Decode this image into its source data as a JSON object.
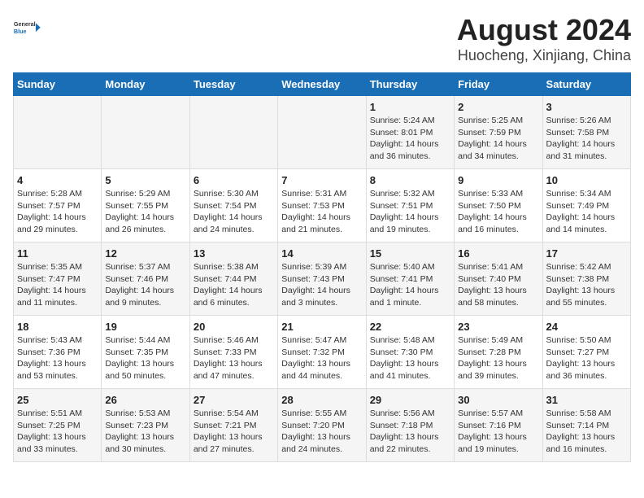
{
  "logo": {
    "line1": "General",
    "line2": "Blue"
  },
  "title": "August 2024",
  "subtitle": "Huocheng, Xinjiang, China",
  "weekdays": [
    "Sunday",
    "Monday",
    "Tuesday",
    "Wednesday",
    "Thursday",
    "Friday",
    "Saturday"
  ],
  "weeks": [
    [
      {
        "day": "",
        "info": ""
      },
      {
        "day": "",
        "info": ""
      },
      {
        "day": "",
        "info": ""
      },
      {
        "day": "",
        "info": ""
      },
      {
        "day": "1",
        "info": "Sunrise: 5:24 AM\nSunset: 8:01 PM\nDaylight: 14 hours\nand 36 minutes."
      },
      {
        "day": "2",
        "info": "Sunrise: 5:25 AM\nSunset: 7:59 PM\nDaylight: 14 hours\nand 34 minutes."
      },
      {
        "day": "3",
        "info": "Sunrise: 5:26 AM\nSunset: 7:58 PM\nDaylight: 14 hours\nand 31 minutes."
      }
    ],
    [
      {
        "day": "4",
        "info": "Sunrise: 5:28 AM\nSunset: 7:57 PM\nDaylight: 14 hours\nand 29 minutes."
      },
      {
        "day": "5",
        "info": "Sunrise: 5:29 AM\nSunset: 7:55 PM\nDaylight: 14 hours\nand 26 minutes."
      },
      {
        "day": "6",
        "info": "Sunrise: 5:30 AM\nSunset: 7:54 PM\nDaylight: 14 hours\nand 24 minutes."
      },
      {
        "day": "7",
        "info": "Sunrise: 5:31 AM\nSunset: 7:53 PM\nDaylight: 14 hours\nand 21 minutes."
      },
      {
        "day": "8",
        "info": "Sunrise: 5:32 AM\nSunset: 7:51 PM\nDaylight: 14 hours\nand 19 minutes."
      },
      {
        "day": "9",
        "info": "Sunrise: 5:33 AM\nSunset: 7:50 PM\nDaylight: 14 hours\nand 16 minutes."
      },
      {
        "day": "10",
        "info": "Sunrise: 5:34 AM\nSunset: 7:49 PM\nDaylight: 14 hours\nand 14 minutes."
      }
    ],
    [
      {
        "day": "11",
        "info": "Sunrise: 5:35 AM\nSunset: 7:47 PM\nDaylight: 14 hours\nand 11 minutes."
      },
      {
        "day": "12",
        "info": "Sunrise: 5:37 AM\nSunset: 7:46 PM\nDaylight: 14 hours\nand 9 minutes."
      },
      {
        "day": "13",
        "info": "Sunrise: 5:38 AM\nSunset: 7:44 PM\nDaylight: 14 hours\nand 6 minutes."
      },
      {
        "day": "14",
        "info": "Sunrise: 5:39 AM\nSunset: 7:43 PM\nDaylight: 14 hours\nand 3 minutes."
      },
      {
        "day": "15",
        "info": "Sunrise: 5:40 AM\nSunset: 7:41 PM\nDaylight: 14 hours\nand 1 minute."
      },
      {
        "day": "16",
        "info": "Sunrise: 5:41 AM\nSunset: 7:40 PM\nDaylight: 13 hours\nand 58 minutes."
      },
      {
        "day": "17",
        "info": "Sunrise: 5:42 AM\nSunset: 7:38 PM\nDaylight: 13 hours\nand 55 minutes."
      }
    ],
    [
      {
        "day": "18",
        "info": "Sunrise: 5:43 AM\nSunset: 7:36 PM\nDaylight: 13 hours\nand 53 minutes."
      },
      {
        "day": "19",
        "info": "Sunrise: 5:44 AM\nSunset: 7:35 PM\nDaylight: 13 hours\nand 50 minutes."
      },
      {
        "day": "20",
        "info": "Sunrise: 5:46 AM\nSunset: 7:33 PM\nDaylight: 13 hours\nand 47 minutes."
      },
      {
        "day": "21",
        "info": "Sunrise: 5:47 AM\nSunset: 7:32 PM\nDaylight: 13 hours\nand 44 minutes."
      },
      {
        "day": "22",
        "info": "Sunrise: 5:48 AM\nSunset: 7:30 PM\nDaylight: 13 hours\nand 41 minutes."
      },
      {
        "day": "23",
        "info": "Sunrise: 5:49 AM\nSunset: 7:28 PM\nDaylight: 13 hours\nand 39 minutes."
      },
      {
        "day": "24",
        "info": "Sunrise: 5:50 AM\nSunset: 7:27 PM\nDaylight: 13 hours\nand 36 minutes."
      }
    ],
    [
      {
        "day": "25",
        "info": "Sunrise: 5:51 AM\nSunset: 7:25 PM\nDaylight: 13 hours\nand 33 minutes."
      },
      {
        "day": "26",
        "info": "Sunrise: 5:53 AM\nSunset: 7:23 PM\nDaylight: 13 hours\nand 30 minutes."
      },
      {
        "day": "27",
        "info": "Sunrise: 5:54 AM\nSunset: 7:21 PM\nDaylight: 13 hours\nand 27 minutes."
      },
      {
        "day": "28",
        "info": "Sunrise: 5:55 AM\nSunset: 7:20 PM\nDaylight: 13 hours\nand 24 minutes."
      },
      {
        "day": "29",
        "info": "Sunrise: 5:56 AM\nSunset: 7:18 PM\nDaylight: 13 hours\nand 22 minutes."
      },
      {
        "day": "30",
        "info": "Sunrise: 5:57 AM\nSunset: 7:16 PM\nDaylight: 13 hours\nand 19 minutes."
      },
      {
        "day": "31",
        "info": "Sunrise: 5:58 AM\nSunset: 7:14 PM\nDaylight: 13 hours\nand 16 minutes."
      }
    ]
  ]
}
